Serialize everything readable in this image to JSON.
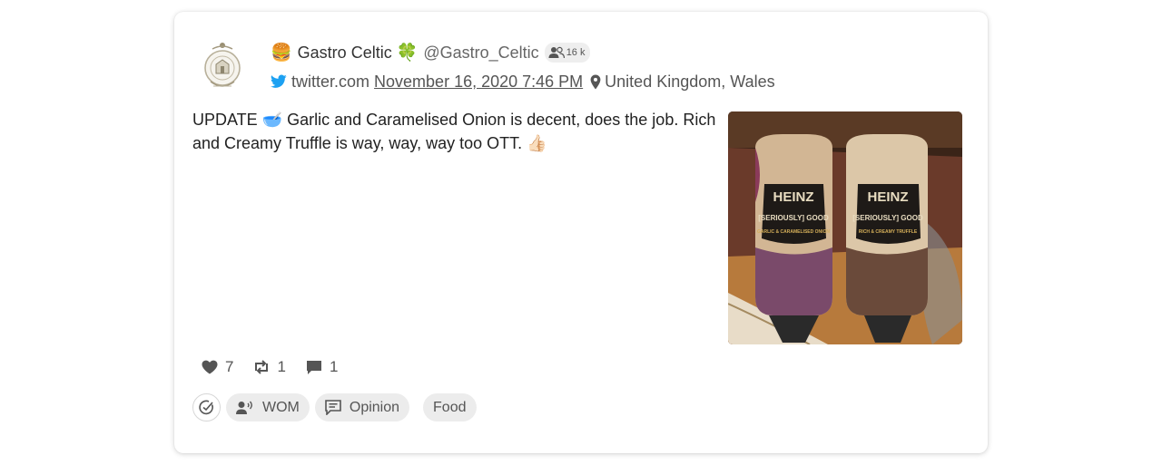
{
  "author": {
    "name": "Gastro Celtic",
    "handle": "@Gastro_Celtic",
    "followers": "16 k",
    "emoji_before": "🍔",
    "emoji_after": "🍀",
    "avatar_icon": "crest-logo-icon"
  },
  "meta": {
    "source": "twitter.com",
    "date": "November 16, 2020 7:46 PM",
    "location": "United Kingdom, Wales",
    "source_icon": "twitter-bird-icon",
    "location_icon": "map-pin-icon"
  },
  "post": {
    "text": "UPDATE 🥣 Garlic and Caramelised Onion is decent, does the job. Rich and Creamy Truffle is way, way, way too OTT. 👍🏻",
    "image_subject": "Heinz Seriously Good mayonnaise bottles",
    "image_labels": {
      "brand": "HEINZ",
      "tagline": "[SERIOUSLY] GOOD",
      "left_flavour": "GARLIC & CARAMELISED ONION",
      "right_flavour": "RICH & CREAMY TRUFFLE"
    }
  },
  "metrics": {
    "likes": "7",
    "retweets": "1",
    "replies": "1"
  },
  "tags": {
    "wom": "WOM",
    "opinion": "Opinion",
    "food": "Food"
  },
  "colors": {
    "twitter_blue": "#1da1f2",
    "chip_bg": "#ececec",
    "icon_gray": "#555555"
  }
}
